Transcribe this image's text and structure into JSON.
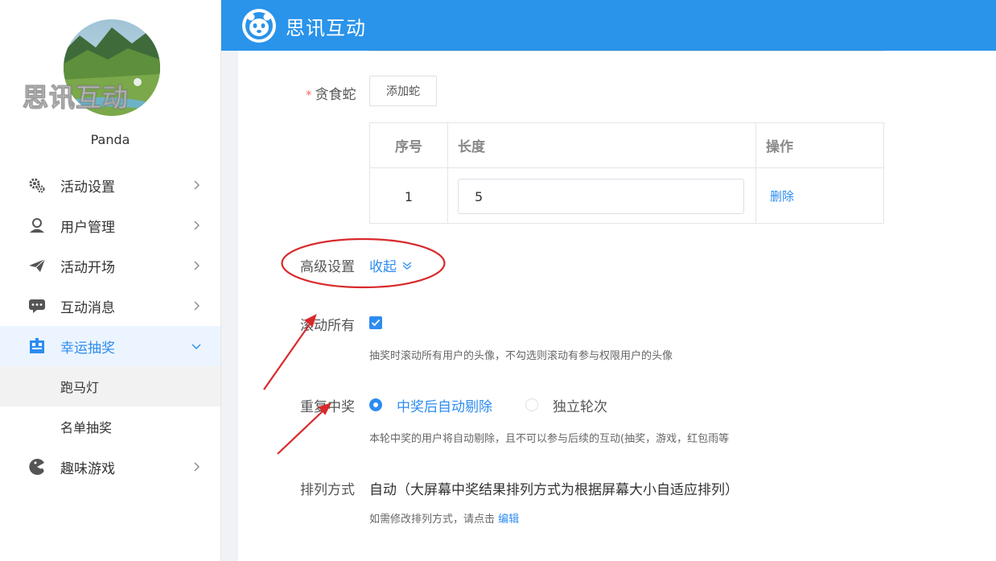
{
  "sidebar": {
    "watermark": "思讯互动",
    "username": "Panda",
    "items": [
      {
        "label": "活动设置",
        "icon": "gears-icon"
      },
      {
        "label": "用户管理",
        "icon": "user-icon"
      },
      {
        "label": "活动开场",
        "icon": "paper-plane-icon"
      },
      {
        "label": "互动消息",
        "icon": "chat-icon"
      },
      {
        "label": "幸运抽奖",
        "icon": "lottery-icon",
        "active": true
      },
      {
        "label": "趣味游戏",
        "icon": "game-icon"
      }
    ],
    "subitems": [
      {
        "label": "跑马灯",
        "selected": true
      },
      {
        "label": "名单抽奖"
      }
    ]
  },
  "header": {
    "brand": "思讯互动",
    "logo_icon": "panda-logo-icon",
    "bg_color": "#2a93ea"
  },
  "form": {
    "snake": {
      "label": "贪食蛇",
      "required_mark": "*",
      "add_button": "添加蛇",
      "table": {
        "headers": [
          "序号",
          "长度",
          "操作"
        ],
        "rows": [
          {
            "index": "1",
            "length": "5",
            "action": "删除"
          }
        ]
      }
    },
    "advanced": {
      "label": "高级设置",
      "toggle_text": "收起"
    },
    "scroll_all": {
      "label": "滚动所有",
      "checked": true,
      "hint": "抽奖时滚动所有用户的头像，不勾选则滚动有参与权限用户的头像"
    },
    "repeat_win": {
      "label": "重复中奖",
      "options": [
        "中奖后自动剔除",
        "独立轮次"
      ],
      "selected": "中奖后自动剔除",
      "hint": "本轮中奖的用户将自动剔除，且不可以参与后续的互动(抽奖，游戏，红包雨等"
    },
    "sort": {
      "label": "排列方式",
      "value": "自动（大屏幕中奖结果排列方式为根据屏幕大小自适应排列）",
      "hint_prefix": "如需修改排列方式，请点击",
      "edit_link": "编辑"
    }
  },
  "colors": {
    "accent": "#2d8cf0",
    "annotation": "#d9292b",
    "required": "#f56c6c"
  }
}
